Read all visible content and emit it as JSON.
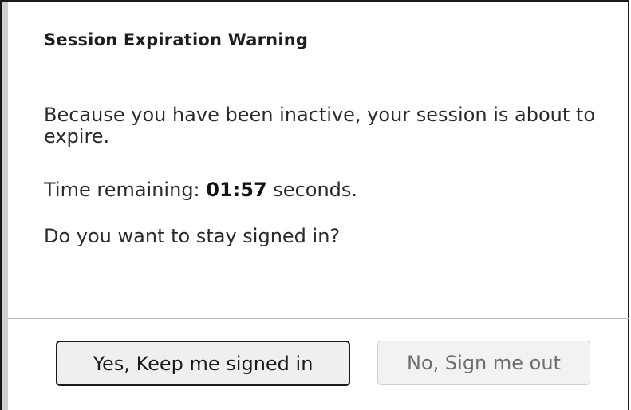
{
  "dialog": {
    "title": "Session Expiration Warning",
    "message": "Because you have been inactive, your session is about to expire.",
    "time_prefix": "Time remaining: ",
    "time_value": "01:57",
    "time_suffix": " seconds.",
    "question": "Do you want to stay signed in?",
    "primary_button_label": "Yes, Keep me signed in",
    "secondary_button_label": "No, Sign me out"
  },
  "colors": {
    "border": "#1a1a1a",
    "accent_strip": "#d0d0d0",
    "divider": "#bdbdbd",
    "primary_button_bg": "#efefef",
    "secondary_button_bg": "#f2f2f2",
    "secondary_button_text": "#6e6e6e"
  }
}
